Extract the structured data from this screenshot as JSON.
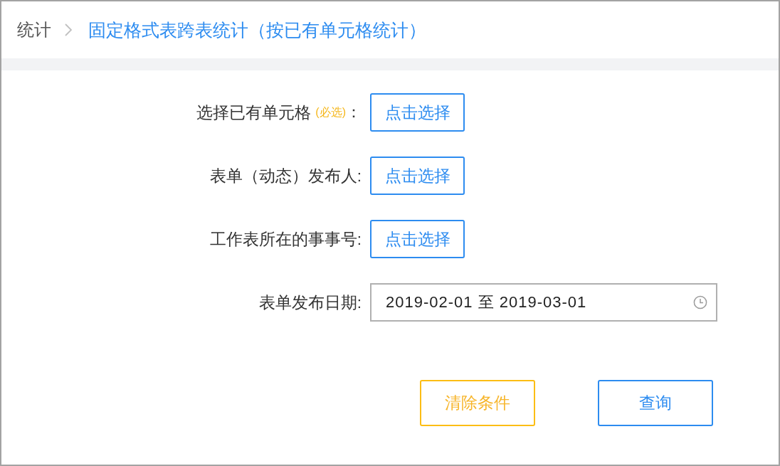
{
  "breadcrumb": [
    {
      "label": "统计",
      "current": false
    },
    {
      "label": "固定格式表跨表统计（按已有单元格统计）",
      "current": true
    }
  ],
  "form": {
    "rows": [
      {
        "kind": "picker",
        "label": "选择已有单元格",
        "note": "(必选)",
        "colon": "：",
        "button": "点击选择"
      },
      {
        "kind": "picker",
        "label": "表单（动态）发布人:",
        "button": "点击选择"
      },
      {
        "kind": "picker",
        "label": "工作表所在的事事号:",
        "button": "点击选择"
      },
      {
        "kind": "date_range",
        "label": "表单发布日期:",
        "value": "2019-02-01 至 2019-03-01"
      }
    ]
  },
  "actions": [
    {
      "label": "清除条件",
      "kind": "warning"
    },
    {
      "label": "查询",
      "kind": "primary"
    }
  ]
}
